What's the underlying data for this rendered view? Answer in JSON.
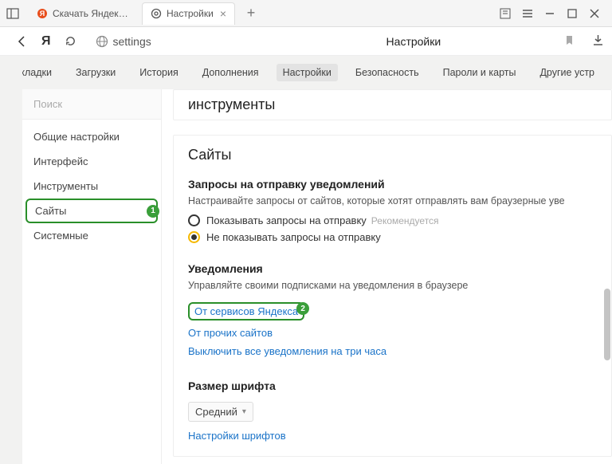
{
  "tabs": [
    {
      "title": "Скачать Яндекс.Браузер д"
    },
    {
      "title": "Настройки"
    }
  ],
  "address": {
    "url": "settings",
    "title": "Настройки"
  },
  "topnav": {
    "items": [
      "Закладки",
      "Загрузки",
      "История",
      "Дополнения",
      "Настройки",
      "Безопасность",
      "Пароли и карты",
      "Другие устр"
    ],
    "selectedIndex": 4
  },
  "sidebar": {
    "searchPlaceholder": "Поиск",
    "items": [
      "Общие настройки",
      "Интерфейс",
      "Инструменты",
      "Сайты",
      "Системные"
    ],
    "activeIndex": 3,
    "badge1": "1"
  },
  "sections": {
    "toolsTitle": "инструменты",
    "sitesTitle": "Сайты",
    "notifReq": {
      "heading": "Запросы на отправку уведомлений",
      "sub": "Настраивайте запросы от сайтов, которые хотят отправлять вам браузерные уве",
      "opt1": "Показывать запросы на отправку",
      "reco": "Рекомендуется",
      "opt2": "Не показывать запросы на отправку"
    },
    "notif": {
      "heading": "Уведомления",
      "sub": "Управляйте своими подписками на уведомления в браузере",
      "link1": "От сервисов Яндекса",
      "badge2": "2",
      "link2": "От прочих сайтов",
      "link3": "Выключить все уведомления на три часа"
    },
    "font": {
      "heading": "Размер шрифта",
      "value": "Средний",
      "link": "Настройки шрифтов"
    }
  }
}
